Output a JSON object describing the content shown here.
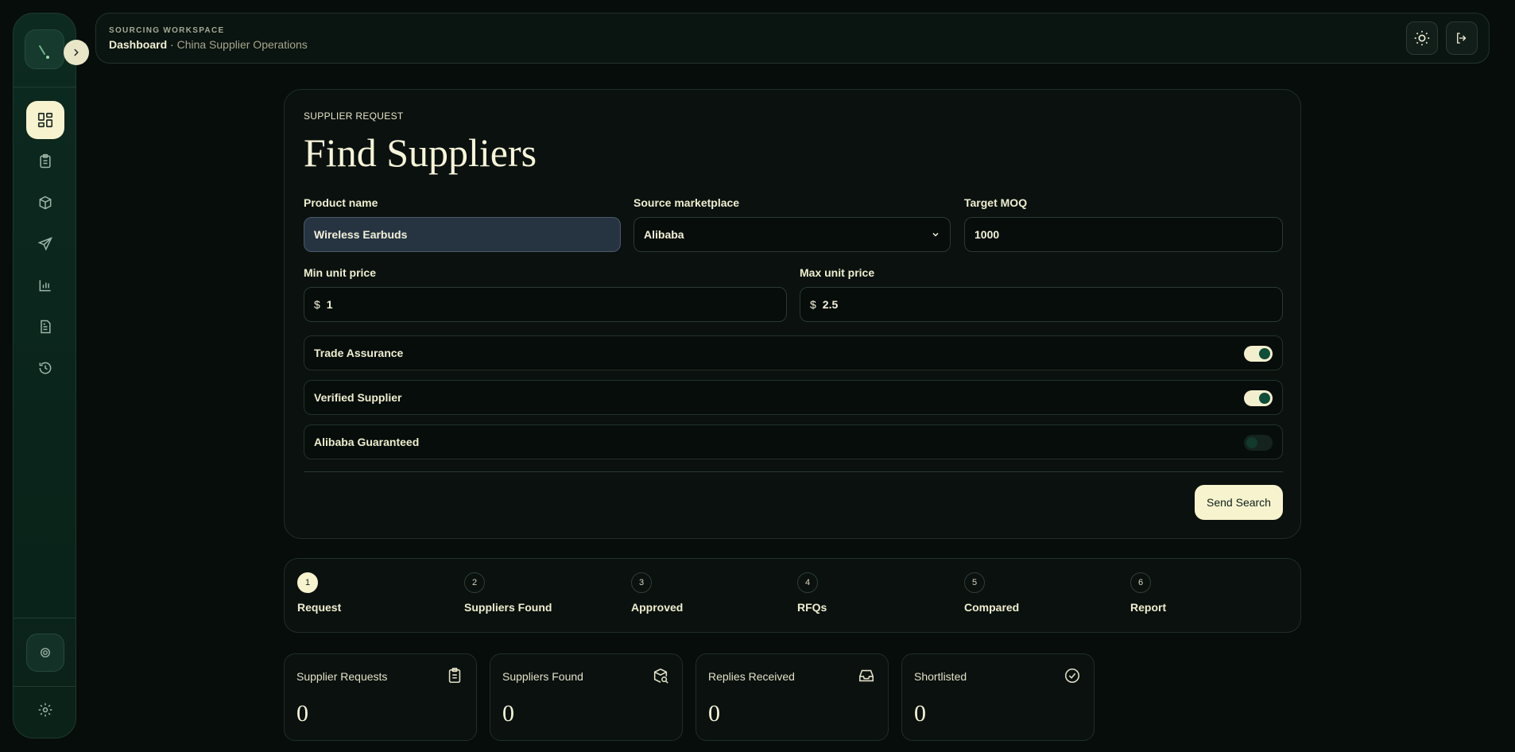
{
  "header": {
    "eyebrow": "SOURCING WORKSPACE",
    "breadcrumb_main": "Dashboard",
    "breadcrumb_sep": " · ",
    "breadcrumb_sub": "China Supplier Operations"
  },
  "sidebar": {
    "items": [
      {
        "name": "dashboard-icon",
        "active": true
      },
      {
        "name": "clipboard-icon",
        "active": false
      },
      {
        "name": "package-icon",
        "active": false
      },
      {
        "name": "send-icon",
        "active": false
      },
      {
        "name": "bar-chart-icon",
        "active": false
      },
      {
        "name": "document-icon",
        "active": false
      },
      {
        "name": "history-icon",
        "active": false
      }
    ]
  },
  "form": {
    "eyebrow": "SUPPLIER REQUEST",
    "title": "Find Suppliers",
    "product_name_label": "Product name",
    "product_name_value": "Wireless Earbuds",
    "marketplace_label": "Source marketplace",
    "marketplace_value": "Alibaba",
    "moq_label": "Target MOQ",
    "moq_value": "1000",
    "min_price_label": "Min unit price",
    "min_price_currency": "$",
    "min_price_value": "1",
    "max_price_label": "Max unit price",
    "max_price_currency": "$",
    "max_price_value": "2.5",
    "toggles": [
      {
        "label": "Trade Assurance",
        "on": true
      },
      {
        "label": "Verified Supplier",
        "on": true
      },
      {
        "label": "Alibaba Guaranteed",
        "on": false
      }
    ],
    "submit_label": "Send Search"
  },
  "steps": [
    {
      "num": "1",
      "label": "Request",
      "active": true
    },
    {
      "num": "2",
      "label": "Suppliers Found",
      "active": false
    },
    {
      "num": "3",
      "label": "Approved",
      "active": false
    },
    {
      "num": "4",
      "label": "RFQs",
      "active": false
    },
    {
      "num": "5",
      "label": "Compared",
      "active": false
    },
    {
      "num": "6",
      "label": "Report",
      "active": false
    }
  ],
  "stats": [
    {
      "title": "Supplier Requests",
      "value": "0",
      "icon": "clipboard-list-icon"
    },
    {
      "title": "Suppliers Found",
      "value": "0",
      "icon": "package-search-icon"
    },
    {
      "title": "Replies Received",
      "value": "0",
      "icon": "inbox-icon"
    },
    {
      "title": "Shortlisted",
      "value": "0",
      "icon": "check-circle-icon"
    }
  ],
  "colors": {
    "accent": "#f7f3cf",
    "background": "#070d0a",
    "sidebar": "#0b2a20",
    "toggle_knob": "#0e4d3a"
  }
}
